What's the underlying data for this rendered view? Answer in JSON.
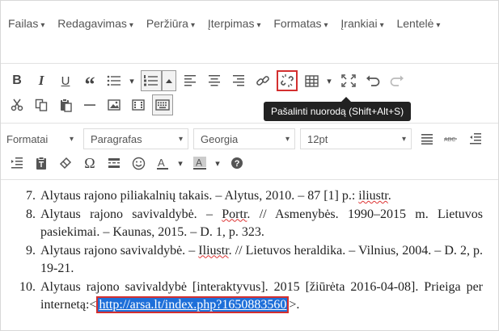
{
  "menubar": {
    "items": [
      {
        "label": "Failas"
      },
      {
        "label": "Redagavimas"
      },
      {
        "label": "Peržiūra"
      },
      {
        "label": "Įterpimas"
      },
      {
        "label": "Formatas"
      },
      {
        "label": "Įrankiai"
      },
      {
        "label": "Lentelė"
      }
    ],
    "caret": "▾"
  },
  "toolbar": {
    "bold": "B",
    "italic": "I",
    "underline": "U",
    "blockquote": "“",
    "formats_label": "Formatai",
    "paragraph_label": "Paragrafas",
    "font_label": "Georgia",
    "size_label": "12pt",
    "omega": "Ω"
  },
  "tooltip": {
    "text": "Pašalinti nuorodą (Shift+Alt+S)"
  },
  "content": {
    "items": [
      {
        "num": "7.",
        "pre": "Alytaus rajono piliakalnių takais. – Alytus, 2010. – 87 [1] p.: ",
        "u": "iliustr",
        "post": "."
      },
      {
        "num": "8.",
        "pre": "Alytaus rajono savivaldybė. – ",
        "u": "Portr",
        "post": ". // Asmenybės. 1990–2015 m. Lietuvos pasiekimai. – Kaunas, 2015. – D. 1, p. 323."
      },
      {
        "num": "9.",
        "pre": "Alytaus rajono savivaldybė. – ",
        "u": "Iliustr",
        "post": ". // Lietuvos heraldika. – Vilnius, 2004. – D. 2, p. 19-21."
      },
      {
        "num": "10.",
        "pre": "Alytaus rajono savivaldybė [interaktyvus]. 2015 [žiūrėta 2016-04-08]. Prieiga per internetą:<",
        "link": "http://arsa.lt/index.php?1650883560",
        "post": ">."
      }
    ]
  }
}
